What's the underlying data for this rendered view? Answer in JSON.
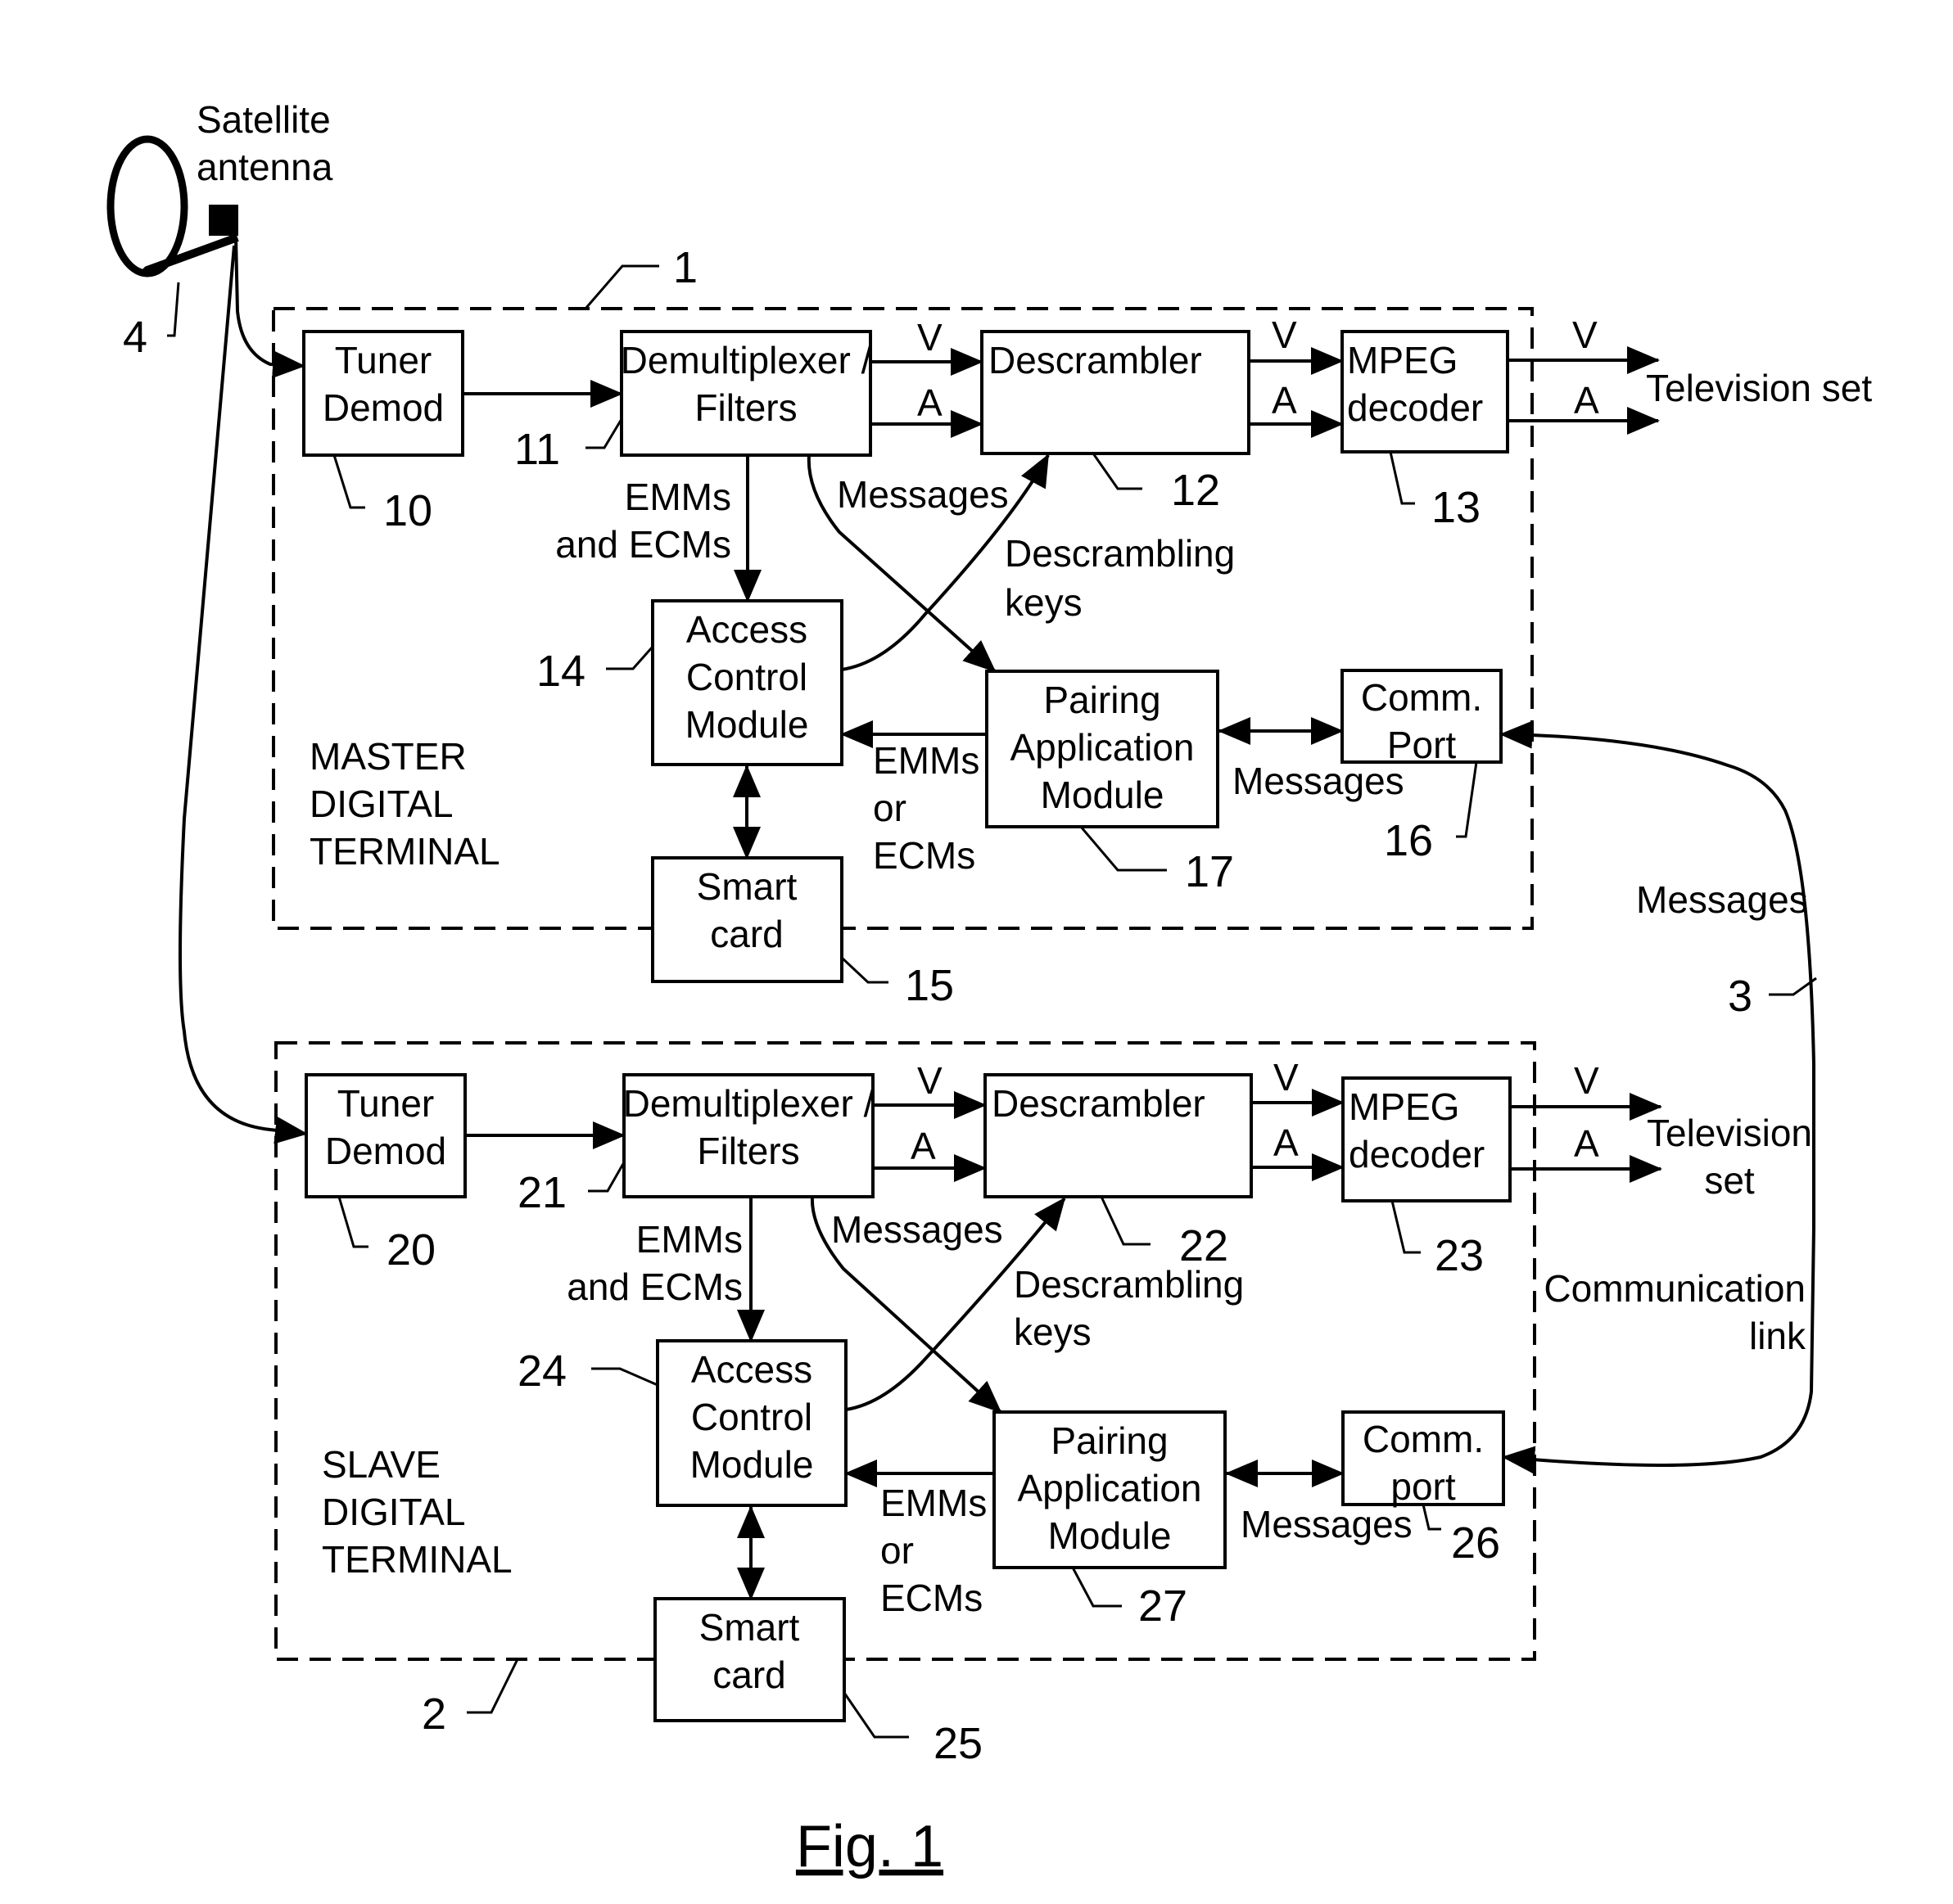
{
  "figure_label": "Fig. 1",
  "antenna": {
    "label_line1": "Satellite",
    "label_line2": "antenna",
    "ref": "4"
  },
  "master": {
    "ref": "1",
    "title_lines": [
      "MASTER",
      "DIGITAL",
      "TERMINAL"
    ],
    "tuner": {
      "lines": [
        "Tuner",
        "Demod"
      ],
      "ref": "10"
    },
    "demux": {
      "lines": [
        "Demultiplexer /",
        "Filters"
      ],
      "ref": "11"
    },
    "descrambler": {
      "label": "Descrambler",
      "ref": "12"
    },
    "mpeg": {
      "lines": [
        "MPEG",
        "decoder"
      ],
      "ref": "13"
    },
    "access": {
      "lines": [
        "Access",
        "Control",
        "Module"
      ],
      "ref": "14"
    },
    "smartcard": {
      "lines": [
        "Smart",
        "card"
      ],
      "ref": "15"
    },
    "comm": {
      "lines": [
        "Comm.",
        "Port"
      ],
      "ref": "16"
    },
    "pairing": {
      "lines": [
        "Pairing",
        "Application",
        "Module"
      ],
      "ref": "17"
    },
    "tv": {
      "lines": [
        "Television set"
      ]
    }
  },
  "slave": {
    "ref": "2",
    "title_lines": [
      "SLAVE",
      "DIGITAL",
      "TERMINAL"
    ],
    "tuner": {
      "lines": [
        "Tuner",
        "Demod"
      ],
      "ref": "20"
    },
    "demux": {
      "lines": [
        "Demultiplexer /",
        "Filters"
      ],
      "ref": "21"
    },
    "descrambler": {
      "label": "Descrambler",
      "ref": "22"
    },
    "mpeg": {
      "lines": [
        "MPEG",
        "decoder"
      ],
      "ref": "23"
    },
    "access": {
      "lines": [
        "Access",
        "Control",
        "Module"
      ],
      "ref": "24"
    },
    "smartcard": {
      "lines": [
        "Smart",
        "card"
      ],
      "ref": "25"
    },
    "comm": {
      "lines": [
        "Comm.",
        "port"
      ],
      "ref": "26"
    },
    "pairing": {
      "lines": [
        "Pairing",
        "Application",
        "Module"
      ],
      "ref": "27"
    },
    "tv": {
      "lines": [
        "Television",
        "set"
      ]
    }
  },
  "signals": {
    "video": "V",
    "audio": "A",
    "emm_ecm_lines": [
      "EMMs",
      "and ECMs"
    ],
    "messages": "Messages",
    "keys_lines": [
      "Descrambling",
      "keys"
    ],
    "emm_or_ecm_lines": [
      "EMMs",
      "or",
      "ECMs"
    ]
  },
  "link": {
    "messages": "Messages",
    "ref": "3",
    "lines": [
      "Communication",
      "link"
    ]
  }
}
